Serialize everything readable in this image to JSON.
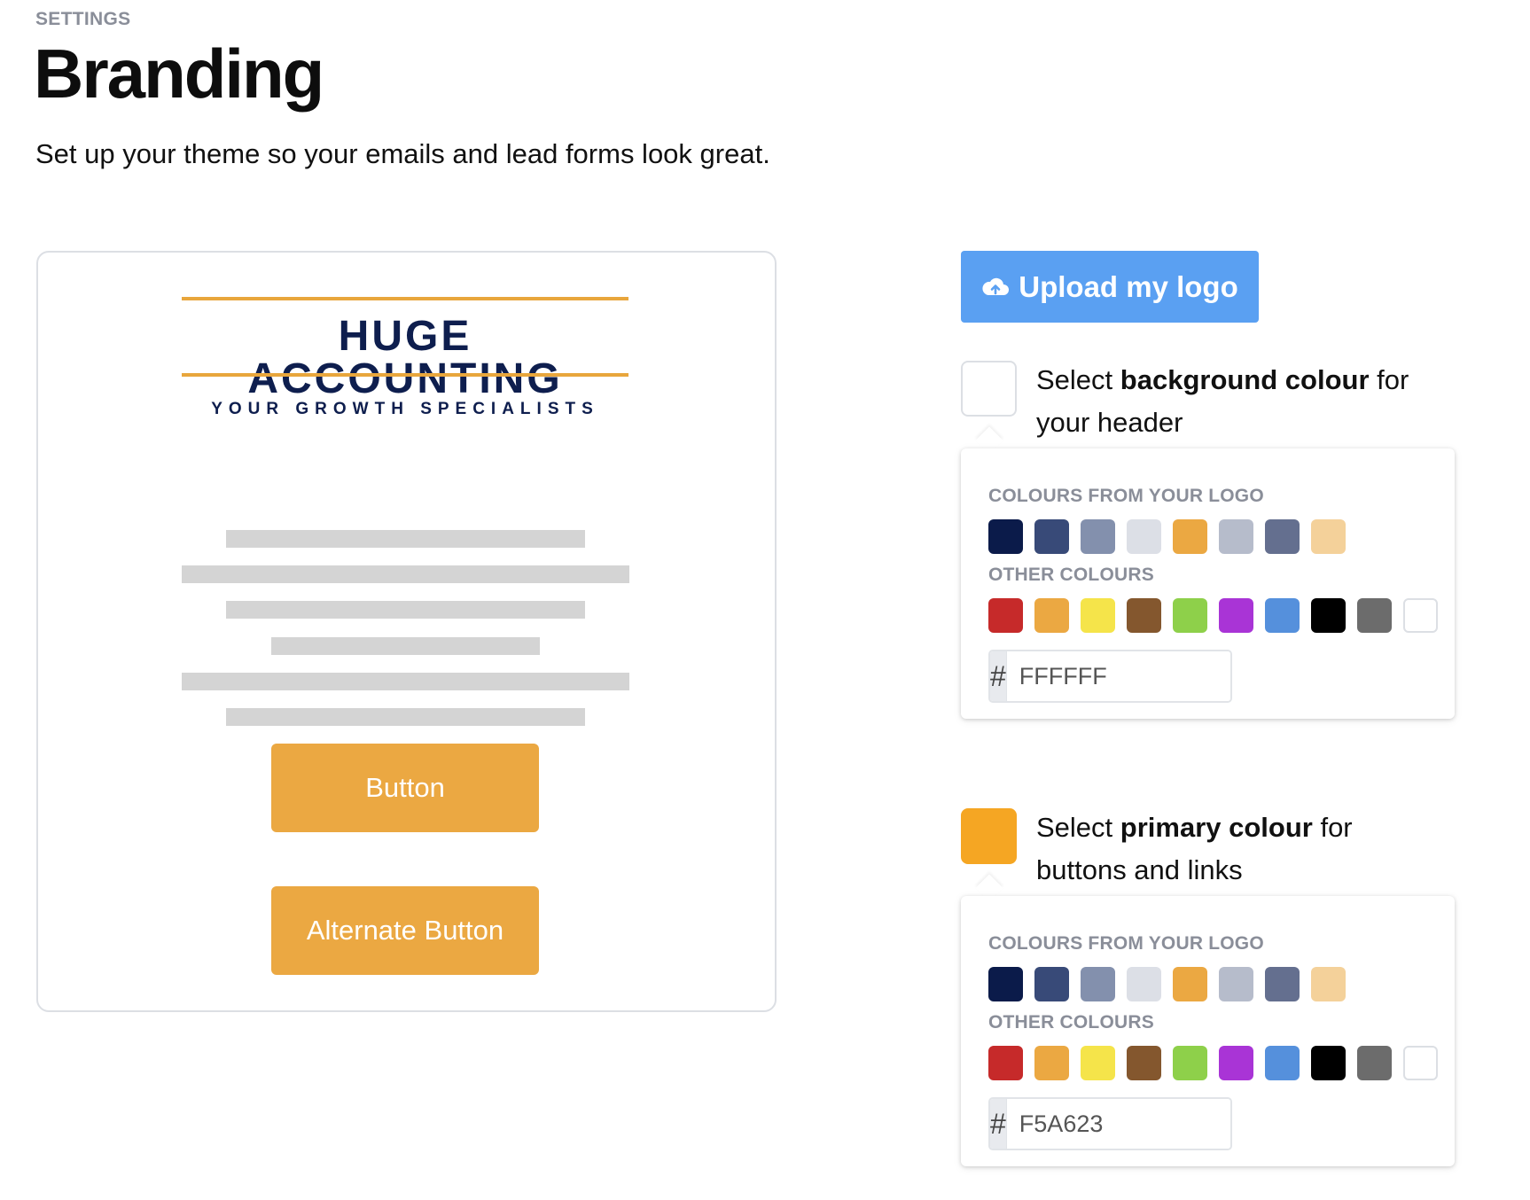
{
  "header": {
    "eyebrow": "SETTINGS",
    "title": "Branding",
    "subtitle": "Set up your theme so your emails and lead forms look great."
  },
  "preview": {
    "logo": {
      "name": "HUGE ACCOUNTING",
      "tagline": "YOUR GROWTH SPECIALISTS",
      "name_color": "#0e1e4e",
      "rule_color": "#e8a63c"
    },
    "button_label": "Button",
    "alternate_button_label": "Alternate Button",
    "button_color": "#eba842",
    "placeholder_color": "#d4d4d4"
  },
  "upload": {
    "label": "Upload my logo",
    "icon": "cloud-upload-icon",
    "color": "#5aa0f2"
  },
  "background_picker": {
    "text_before": "Select ",
    "text_bold": "background colour",
    "text_after": " for your header",
    "selected_color": "#FFFFFF",
    "logo_colours_label": "COLOURS FROM YOUR LOGO",
    "other_colours_label": "OTHER COLOURS",
    "hex_prefix": "#",
    "hex_value": "FFFFFF"
  },
  "primary_picker": {
    "text_before": "Select ",
    "text_bold": "primary colour",
    "text_after": " for buttons and links",
    "selected_color": "#F5A623",
    "logo_colours_label": "COLOURS FROM YOUR LOGO",
    "other_colours_label": "OTHER COLOURS",
    "hex_prefix": "#",
    "hex_value": "F5A623"
  },
  "palettes": {
    "logo_colours": [
      "#0b1b4a",
      "#384a78",
      "#8390ad",
      "#dcdfe6",
      "#eba842",
      "#b6bccb",
      "#646f8f",
      "#f4d19a"
    ],
    "other_colours": [
      "#c62a2a",
      "#eba842",
      "#f5e44a",
      "#84572e",
      "#8ed04a",
      "#a934d6",
      "#5590dc",
      "#000000",
      "#6c6c6c",
      "#ffffff"
    ]
  }
}
